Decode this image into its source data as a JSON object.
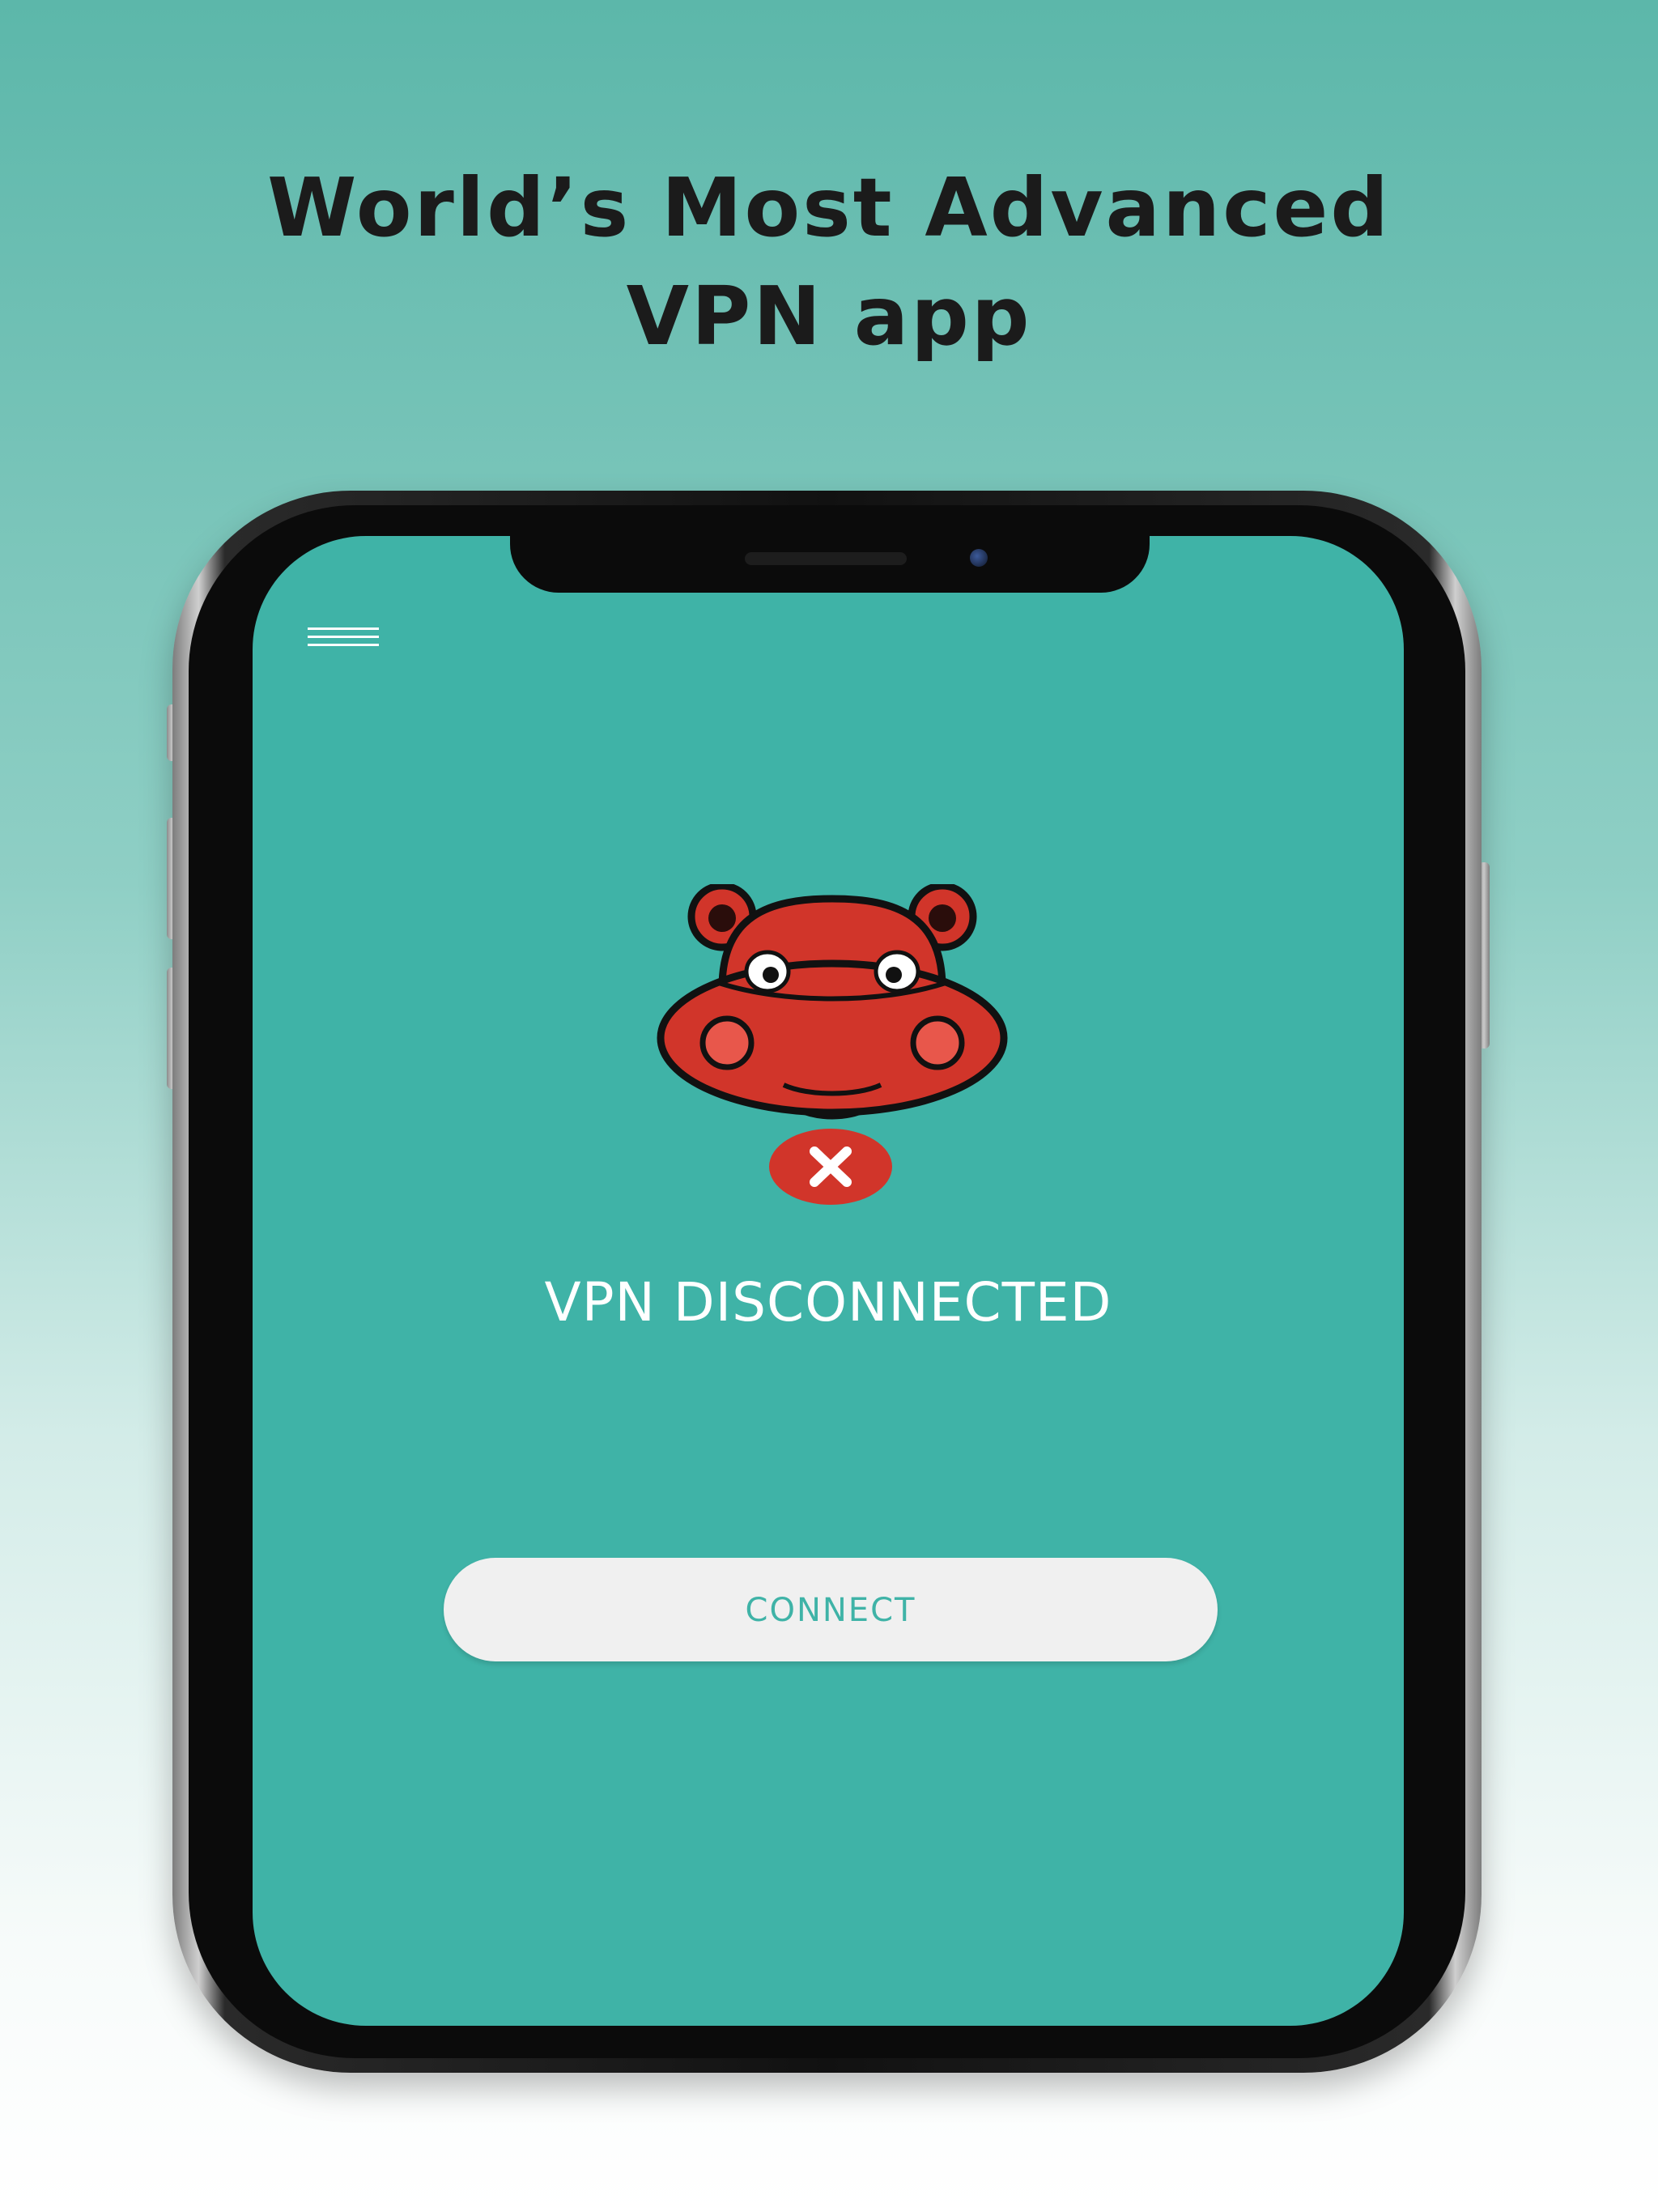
{
  "headline": {
    "line1": "World’s Most Advanced",
    "line2": "VPN app"
  },
  "app": {
    "menu_icon": "hamburger-menu-icon",
    "logo_icon": "hippo-mascot-icon",
    "status_icon": "close-x-icon",
    "status_text": "VPN DISCONNECTED",
    "connect_label": "CONNECT"
  },
  "colors": {
    "screen_background": "#3fb3a7",
    "accent_red": "#d1352a",
    "button_background": "#f0f0f0",
    "headline_text": "#1b1b1b"
  }
}
